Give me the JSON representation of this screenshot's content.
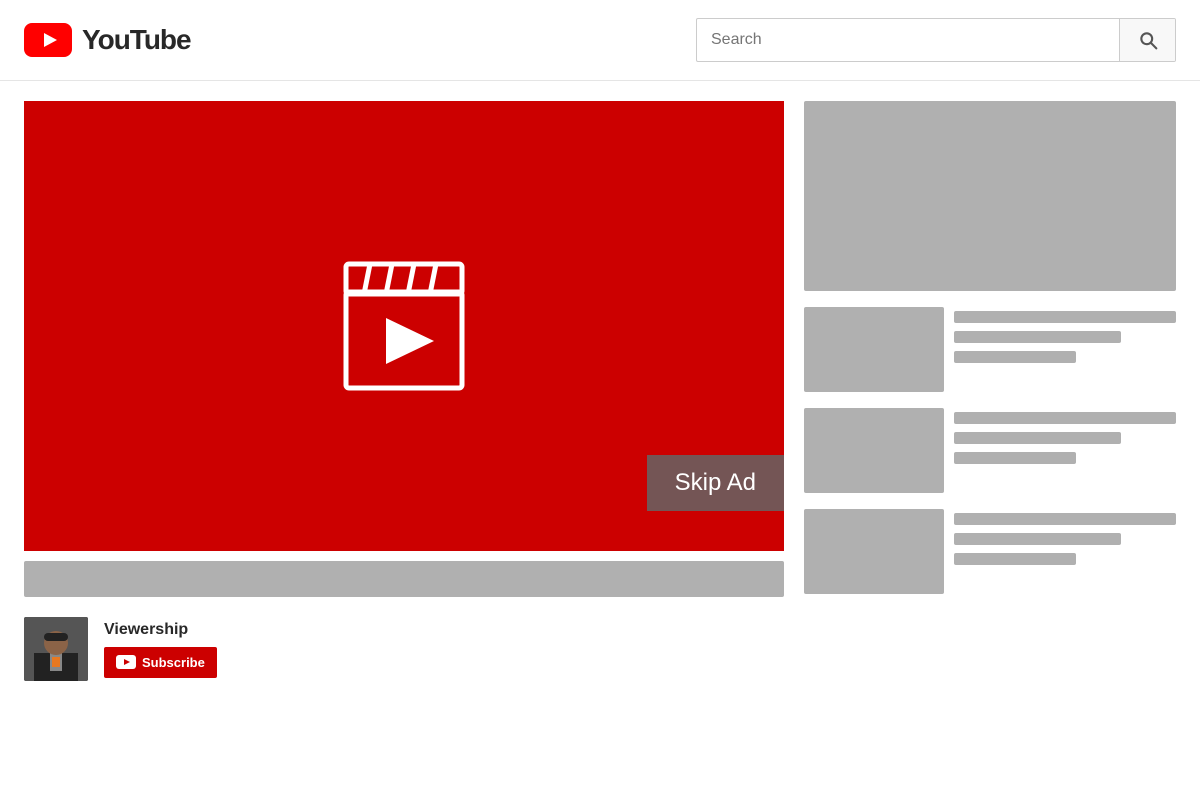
{
  "header": {
    "logo_text": "YouTube",
    "search_placeholder": "Search",
    "search_btn_icon": "search-icon"
  },
  "player": {
    "skip_ad_label": "Skip Ad"
  },
  "channel": {
    "name": "Viewership",
    "subscribe_label": "Subscribe"
  },
  "sidebar": {
    "ad_banner_alt": "Advertisement banner",
    "recommended": [
      {
        "id": 1,
        "lines": [
          "long",
          "medium",
          "short"
        ]
      },
      {
        "id": 2,
        "lines": [
          "long",
          "medium",
          "short"
        ]
      },
      {
        "id": 3,
        "lines": [
          "long",
          "medium",
          "short"
        ]
      }
    ]
  }
}
